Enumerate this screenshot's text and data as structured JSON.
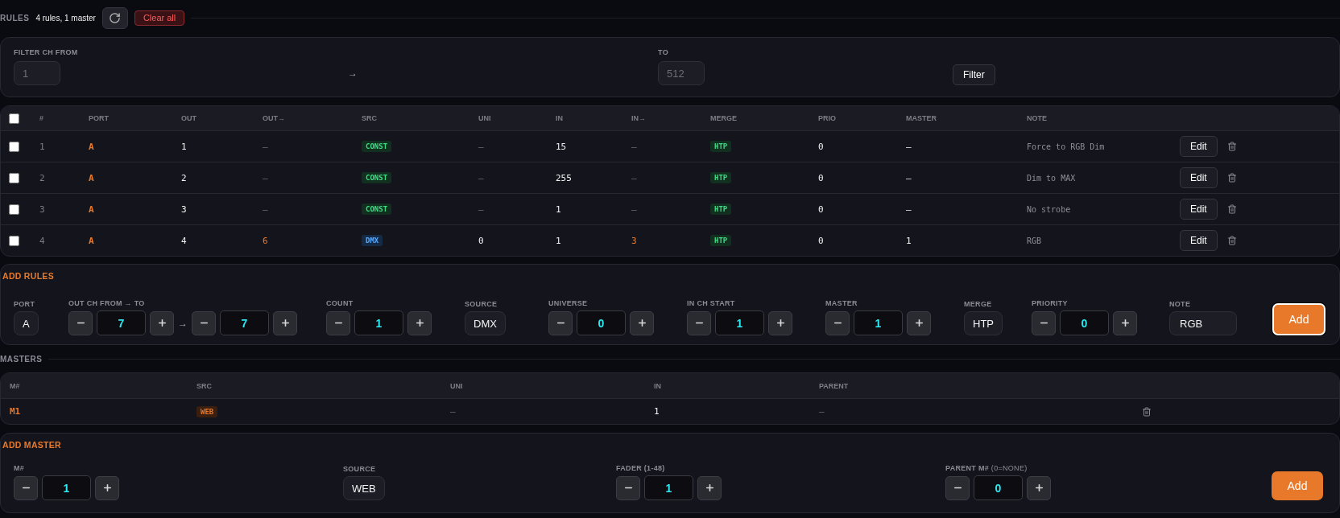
{
  "header": {
    "title": "RULES",
    "summary": "4 rules, 1 master",
    "clear_label": "Clear all"
  },
  "filter": {
    "from_label": "FILTER CH FROM",
    "from_placeholder": "1",
    "arrow": "→",
    "to_label": "TO",
    "to_placeholder": "512",
    "button": "Filter"
  },
  "rules_table": {
    "all_checked": false,
    "columns": [
      "#",
      "PORT",
      "OUT",
      "OUT→",
      "SRC",
      "UNI",
      "IN",
      "IN→",
      "MERGE",
      "PRIO",
      "MASTER",
      "NOTE"
    ],
    "rows": [
      {
        "checked": false,
        "number": "1",
        "port": "A",
        "out": "1",
        "out_to": "—",
        "src": "CONST",
        "kind": "const",
        "uni": "—",
        "in": "15",
        "in_to": "—",
        "merge": "HTP",
        "prio": "0",
        "master": "—",
        "note": "Force to RGB Dim",
        "edit": "Edit"
      },
      {
        "checked": false,
        "number": "2",
        "port": "A",
        "out": "2",
        "out_to": "—",
        "src": "CONST",
        "kind": "const",
        "uni": "—",
        "in": "255",
        "in_to": "—",
        "merge": "HTP",
        "prio": "0",
        "master": "—",
        "note": "Dim to MAX",
        "edit": "Edit"
      },
      {
        "checked": false,
        "number": "3",
        "port": "A",
        "out": "3",
        "out_to": "—",
        "src": "CONST",
        "kind": "const",
        "uni": "—",
        "in": "1",
        "in_to": "—",
        "merge": "HTP",
        "prio": "0",
        "master": "—",
        "note": "No strobe",
        "edit": "Edit"
      },
      {
        "checked": false,
        "number": "4",
        "port": "A",
        "out": "4",
        "out_to": "6",
        "src": "DMX",
        "kind": "dmx",
        "uni": "0",
        "in": "1",
        "in_to": "3",
        "merge": "HTP",
        "prio": "0",
        "master": "1",
        "note": "RGB",
        "edit": "Edit"
      }
    ]
  },
  "add_rules": {
    "title": "ADD RULES",
    "button": "Add",
    "button_focused": true,
    "fields": [
      {
        "kind": "select",
        "label": "PORT",
        "value": "A"
      },
      {
        "kind": "range",
        "label": "OUT CH FROM → TO",
        "from": "7",
        "arrow": "→",
        "to": "7"
      },
      {
        "kind": "stepper",
        "label": "COUNT",
        "value": "1"
      },
      {
        "kind": "select",
        "label": "SOURCE",
        "value": "DMX"
      },
      {
        "kind": "stepper",
        "label": "UNIVERSE",
        "value": "0"
      },
      {
        "kind": "stepper",
        "label": "IN CH START",
        "value": "1"
      },
      {
        "kind": "stepper",
        "label": "MASTER",
        "value": "1"
      },
      {
        "kind": "select",
        "label": "MERGE",
        "value": "HTP"
      },
      {
        "kind": "stepper",
        "label": "PRIORITY",
        "value": "0"
      },
      {
        "kind": "text",
        "label": "NOTE",
        "value": "RGB"
      }
    ]
  },
  "masters": {
    "title": "MASTERS",
    "columns": [
      "M#",
      "SRC",
      "UNI",
      "IN",
      "PARENT"
    ],
    "rows": [
      {
        "id": "M1",
        "src": "WEB",
        "kind": "web",
        "uni": "—",
        "in": "1",
        "parent": "—"
      }
    ]
  },
  "add_master": {
    "title": "ADD MASTER",
    "button": "Add",
    "button_focused": false,
    "fields": [
      {
        "kind": "stepper",
        "label": "M#",
        "value": "1"
      },
      {
        "kind": "select",
        "label": "SOURCE",
        "value": "WEB"
      },
      {
        "kind": "stepper",
        "label": "FADER (1-48)",
        "value": "1"
      },
      {
        "kind": "stepper",
        "label": "PARENT M#",
        "hint": "(0=NONE)",
        "value": "0"
      }
    ]
  }
}
